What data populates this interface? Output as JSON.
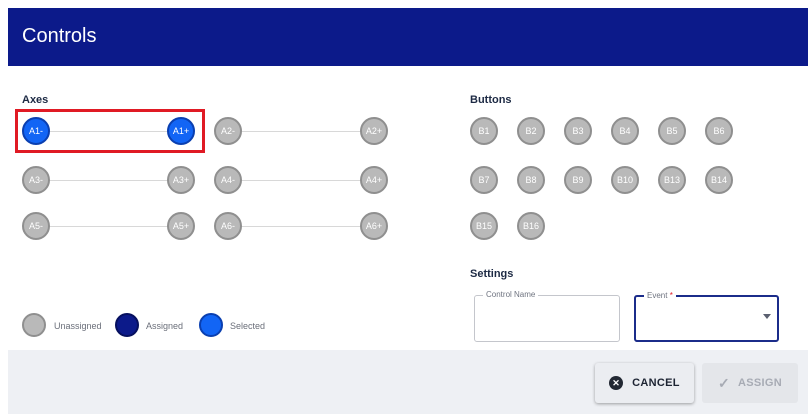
{
  "header": {
    "title": "Controls"
  },
  "axes": {
    "label": "Axes",
    "rows": [
      {
        "left": "A1-",
        "right": "A1+",
        "left_state": "selected",
        "right_state": "selected"
      },
      {
        "left": "A2-",
        "right": "A2+",
        "left_state": "unassigned",
        "right_state": "unassigned"
      },
      {
        "left": "A3-",
        "right": "A3+",
        "left_state": "unassigned",
        "right_state": "unassigned"
      },
      {
        "left": "A4-",
        "right": "A4+",
        "left_state": "unassigned",
        "right_state": "unassigned"
      },
      {
        "left": "A5-",
        "right": "A5+",
        "left_state": "unassigned",
        "right_state": "unassigned"
      },
      {
        "left": "A6-",
        "right": "A6+",
        "left_state": "unassigned",
        "right_state": "unassigned"
      }
    ]
  },
  "buttons": {
    "label": "Buttons",
    "items": [
      "B1",
      "B2",
      "B3",
      "B4",
      "B5",
      "B6",
      "B7",
      "B8",
      "B9",
      "B10",
      "B13",
      "B14",
      "B15",
      "B16"
    ]
  },
  "legend": {
    "unassigned": "Unassigned",
    "assigned": "Assigned",
    "selected": "Selected"
  },
  "settings": {
    "label": "Settings",
    "control_name": {
      "label": "Control Name",
      "value": ""
    },
    "event": {
      "label": "Event",
      "required_mark": "*",
      "value": ""
    }
  },
  "footer": {
    "cancel_label": "CANCEL",
    "assign_label": "ASSIGN"
  },
  "colors": {
    "header": "#0c1a8a",
    "unassigned": "#b9b9b9",
    "assigned": "#0c1a8a",
    "selected": "#1265f5",
    "highlight": "#e01a24"
  },
  "icons": {
    "cancel": "x-circle-icon",
    "assign": "check-icon",
    "dropdown": "caret-down-icon"
  }
}
